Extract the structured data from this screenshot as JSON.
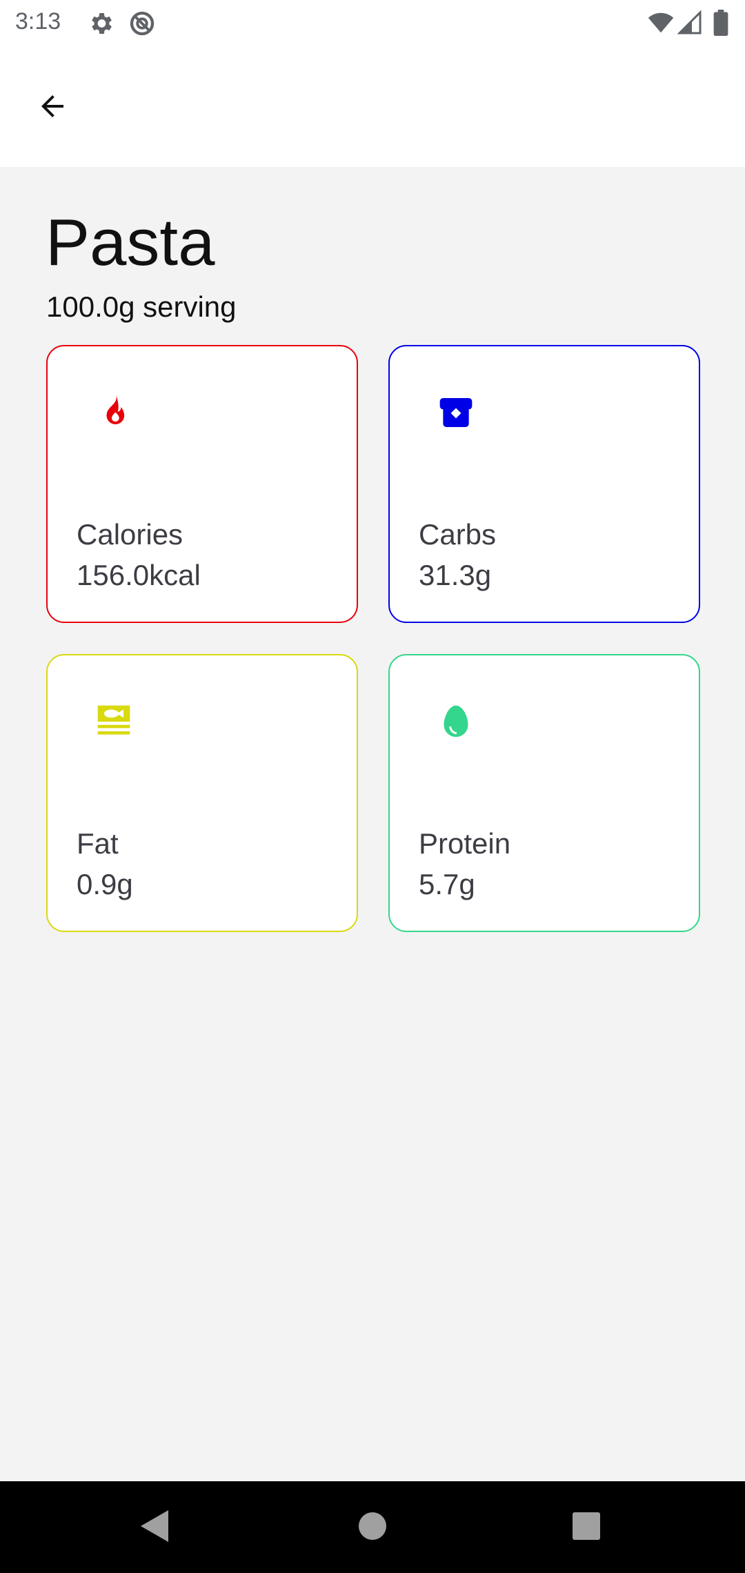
{
  "status_bar": {
    "time": "3:13",
    "left_icons": [
      "gear-icon",
      "do-not-disturb-icon"
    ],
    "right_icons": [
      "wifi-icon",
      "cell-signal-icon",
      "battery-icon"
    ]
  },
  "app_bar": {
    "back_icon": "arrow-back-icon"
  },
  "food": {
    "name": "Pasta",
    "serving": "100.0g serving"
  },
  "nutrients": [
    {
      "label": "Calories",
      "value": "156.0kcal",
      "color": "#e8000b",
      "icon": "flame-icon"
    },
    {
      "label": "Carbs",
      "value": "31.3g",
      "color": "#0000e6",
      "icon": "bread-icon"
    },
    {
      "label": "Fat",
      "value": "0.9g",
      "color": "#d9d90f",
      "icon": "oil-icon"
    },
    {
      "label": "Protein",
      "value": "5.7g",
      "color": "#33d68c",
      "icon": "egg-icon"
    }
  ],
  "nav_bar": {
    "buttons": [
      "back-triangle-icon",
      "home-circle-icon",
      "recents-square-icon"
    ]
  }
}
